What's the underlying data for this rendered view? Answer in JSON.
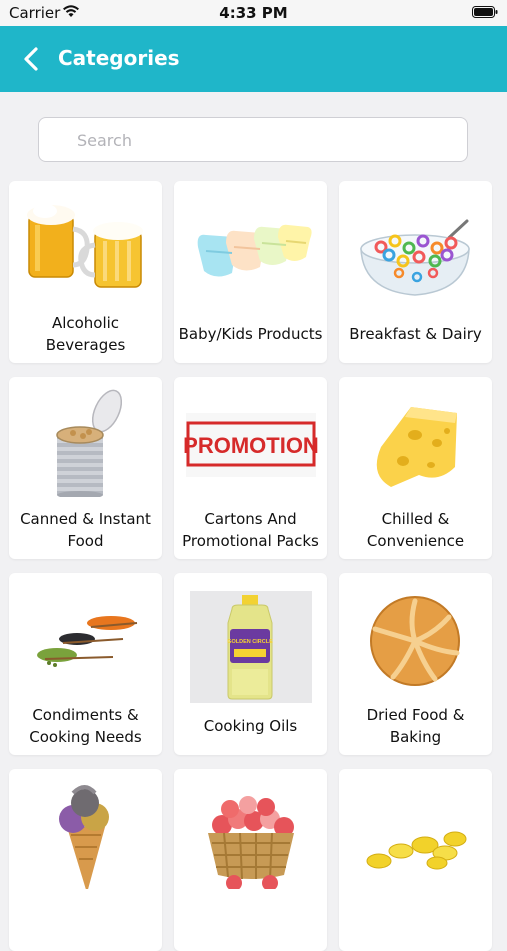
{
  "status_bar": {
    "carrier": "Carrier",
    "time": "4:33 PM",
    "icons": [
      "wifi-icon",
      "battery-icon"
    ]
  },
  "header": {
    "title": "Categories",
    "back_icon": "chevron-left-icon",
    "background_color": "#1fb6c9"
  },
  "search": {
    "placeholder": "Search",
    "value": ""
  },
  "categories": [
    {
      "label": "Alcoholic Beverages",
      "icon": "beer-mugs-image"
    },
    {
      "label": "Baby/Kids Products",
      "icon": "diapers-image"
    },
    {
      "label": "Breakfast & Dairy",
      "icon": "cereal-bowl-image"
    },
    {
      "label": "Canned & Instant Food",
      "icon": "open-can-image"
    },
    {
      "label": "Cartons And Promotional Packs",
      "icon": "promotion-stamp-image"
    },
    {
      "label": "Chilled & Convenience",
      "icon": "cheese-image"
    },
    {
      "label": "Condiments & Cooking Needs",
      "icon": "spices-image"
    },
    {
      "label": "Cooking Oils",
      "icon": "oil-bottle-image"
    },
    {
      "label": "Dried Food & Baking",
      "icon": "bread-roll-image"
    },
    {
      "label": "",
      "icon": "ice-cream-cone-image"
    },
    {
      "label": "",
      "icon": "fruit-basket-image"
    },
    {
      "label": "",
      "icon": "supplement-capsules-image"
    }
  ],
  "promotion_text": "PROMOTION",
  "oil_bottle_text": "GOLDEN CIRCLE"
}
